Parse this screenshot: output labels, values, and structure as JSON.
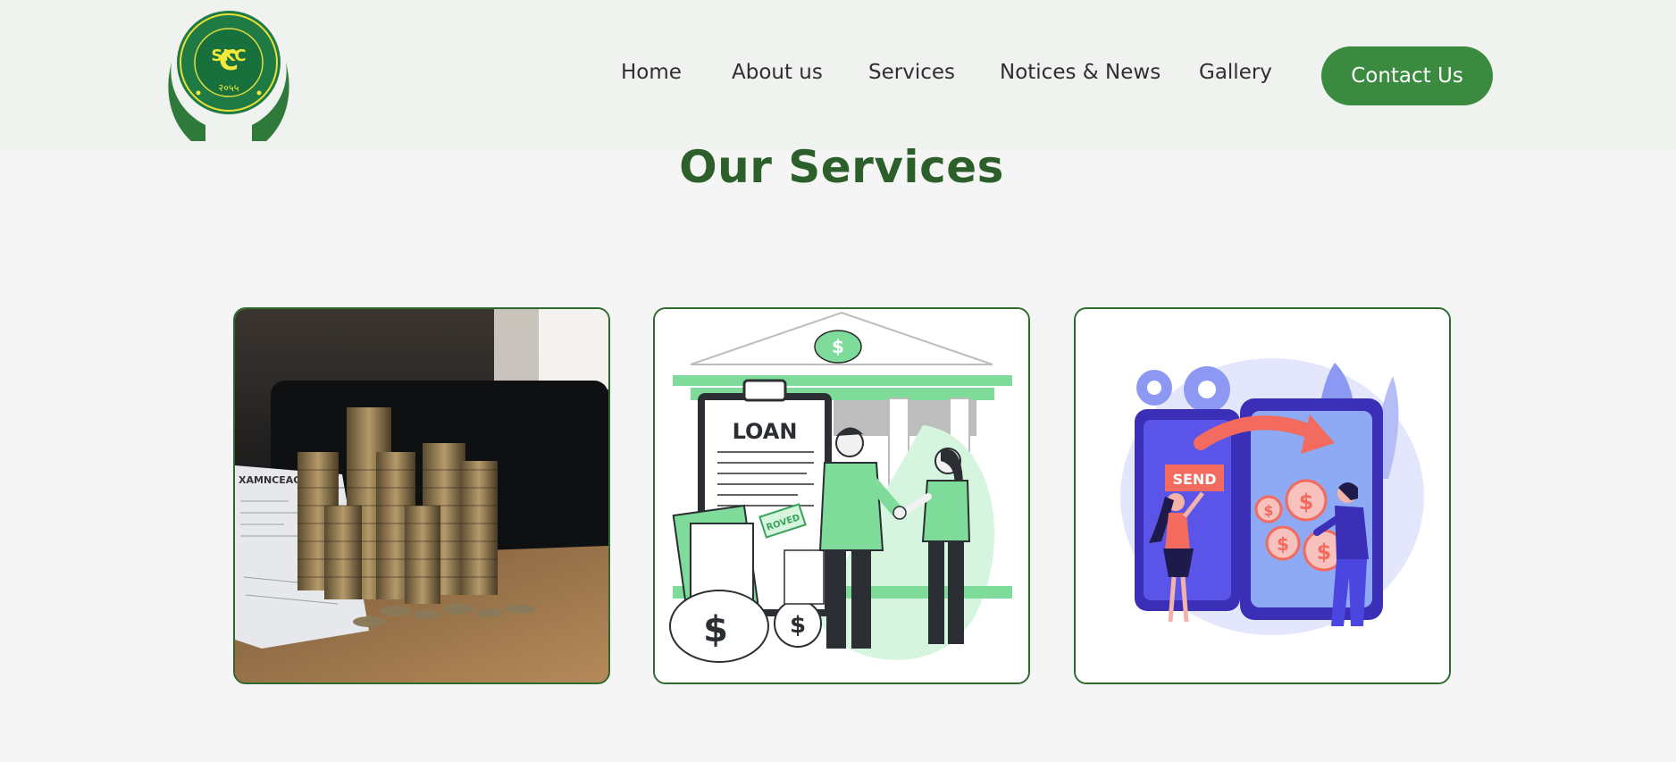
{
  "header": {
    "logo": {
      "icon": "cooperative-logo-icon",
      "letters": "SKC",
      "year": "२०५५",
      "ring_text": "काठमाडौं बचत तथा ऋण सहकारी संस्था लि."
    },
    "nav": [
      {
        "label": "Home"
      },
      {
        "label": "About us"
      },
      {
        "label": "Services"
      },
      {
        "label": "Notices & News"
      },
      {
        "label": "Gallery"
      }
    ],
    "contact_label": "Contact Us"
  },
  "main": {
    "title": "Our Services",
    "cards": [
      {
        "image": "coin-stacks-photo",
        "doc_text": "XAMNCEACC"
      },
      {
        "image": "loan-handshake-illustration",
        "doc_title": "LOAN",
        "stamp": "ROVED"
      },
      {
        "image": "money-transfer-illustration",
        "button_text": "SEND"
      }
    ]
  },
  "colors": {
    "brand_green": "#3a8a3f",
    "title_green": "#2c5f2a",
    "card_border": "#2e6a2e",
    "header_bg": "#eff2ef",
    "page_bg": "#f4f5f4"
  }
}
